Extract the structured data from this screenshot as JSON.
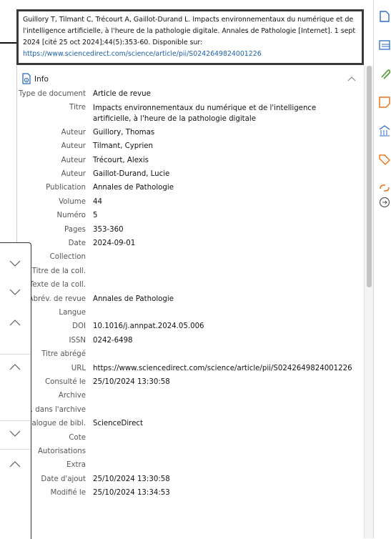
{
  "citation": {
    "text": "Guillory T, Tilmant C, Trécourt A, Gaillot-Durand L. Impacts environnementaux du numérique et de l'intelligence artificielle, à l'heure de la pathologie digitale. Annales de Pathologie [Internet]. 1 sept 2024 [cité 25 oct 2024];44(5):353-60. Disponible sur:",
    "url": "https://www.sciencedirect.com/science/article/pii/S0242649824001226"
  },
  "section": {
    "title": "Info"
  },
  "fields": [
    {
      "label": "Type de document",
      "value": "Article de revue"
    },
    {
      "label": "Titre",
      "value": "Impacts environnementaux du numérique et de l'intelligence artificielle, à l'heure de la pathologie digitale"
    },
    {
      "label": "Auteur",
      "value": "Guillory, Thomas"
    },
    {
      "label": "Auteur",
      "value": "Tilmant, Cyprien"
    },
    {
      "label": "Auteur",
      "value": "Trécourt, Alexis"
    },
    {
      "label": "Auteur",
      "value": "Gaillot-Durand, Lucie"
    },
    {
      "label": "Publication",
      "value": "Annales de Pathologie"
    },
    {
      "label": "Volume",
      "value": "44"
    },
    {
      "label": "Numéro",
      "value": "5"
    },
    {
      "label": "Pages",
      "value": "353-360"
    },
    {
      "label": "Date",
      "value": "2024-09-01"
    },
    {
      "label": "Collection",
      "value": ""
    },
    {
      "label": "Titre de la coll.",
      "value": ""
    },
    {
      "label": "Texte de la coll.",
      "value": ""
    },
    {
      "label": "Abrév. de revue",
      "value": "Annales de Pathologie"
    },
    {
      "label": "Langue",
      "value": ""
    },
    {
      "label": "DOI",
      "value": "10.1016/j.annpat.2024.05.006"
    },
    {
      "label": "ISSN",
      "value": "0242-6498"
    },
    {
      "label": "Titre abrégé",
      "value": ""
    },
    {
      "label": "URL",
      "value": "https://www.sciencedirect.com/science/article/pii/S0242649824001226"
    },
    {
      "label": "Consulté le",
      "value": "25/10/2024 13:30:58"
    },
    {
      "label": "Archive",
      "value": ""
    },
    {
      "label": ". dans l'archive",
      "value": ""
    },
    {
      "label": "alogue de bibl.",
      "value": "ScienceDirect"
    },
    {
      "label": "Cote",
      "value": ""
    },
    {
      "label": "Autorisations",
      "value": ""
    },
    {
      "label": "Extra",
      "value": ""
    },
    {
      "label": "Date d'ajout",
      "value": "25/10/2024 13:30:58"
    },
    {
      "label": "Modifié le",
      "value": "25/10/2024 13:34:53"
    }
  ],
  "colors": {
    "accent_blue": "#2b6cc4",
    "accent_orange": "#e8731a",
    "accent_green": "#4a9a2e",
    "url_blue": "#1b5fa8"
  },
  "floating_toolbar": [
    "chevron-down-icon",
    "chevron-down-icon",
    "chevron-up-icon",
    "chevron-up-icon",
    "chevron-down-icon",
    "chevron-up-icon"
  ],
  "side_nav": [
    "document-icon",
    "abstract-icon",
    "attachment-icon",
    "notes-icon",
    "libraries-icon",
    "tag-icon",
    "related-icon",
    "locate-icon"
  ]
}
